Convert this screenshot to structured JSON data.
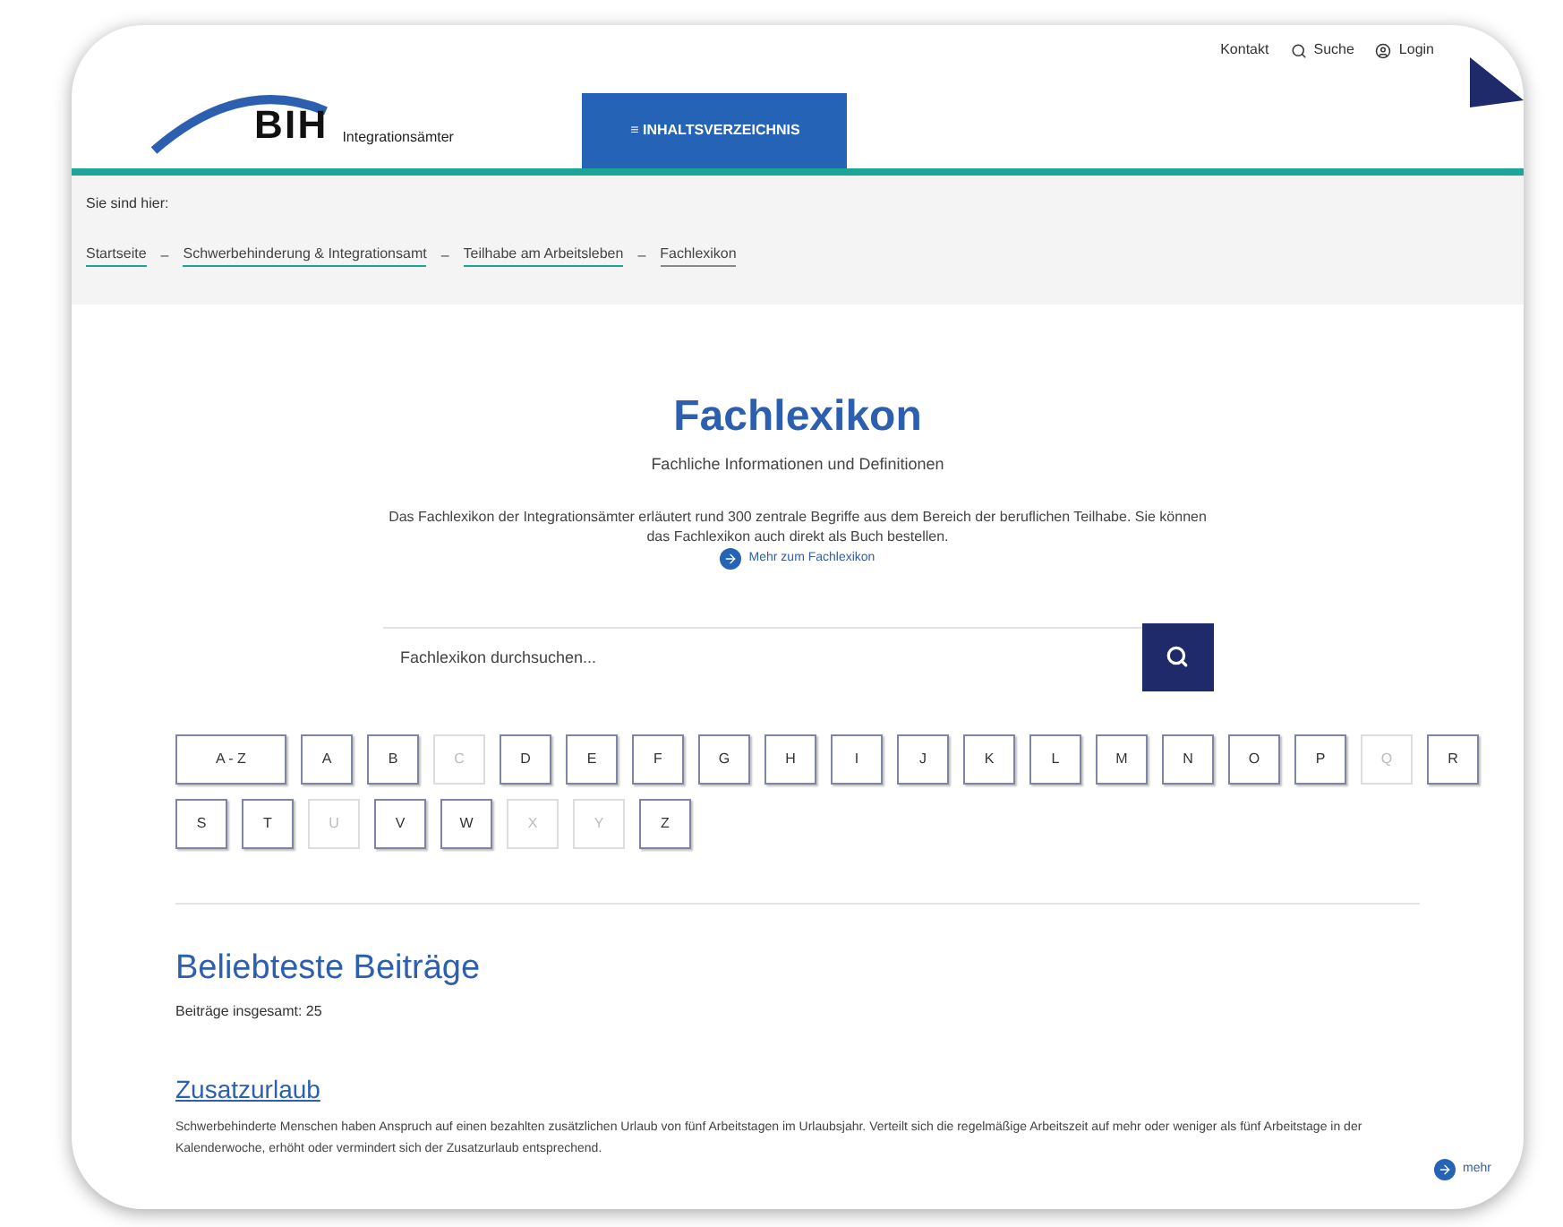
{
  "header": {
    "logo_text": "BIH",
    "logo_subtitle": "Integrationsämter",
    "menu_button": "≡ INHALTSVERZEICHNIS",
    "top_links": [
      {
        "kind": "text",
        "label": "Kontakt"
      },
      {
        "kind": "search",
        "label": "Suche"
      },
      {
        "kind": "login",
        "label": "Login"
      }
    ]
  },
  "breadcrumb": {
    "label": "Sie sind hier:",
    "separator": "–",
    "items": [
      {
        "label": "Startseite",
        "current": false
      },
      {
        "label": "Schwerbehinderung & Integrationsamt",
        "current": false
      },
      {
        "label": "Teilhabe am Arbeitsleben",
        "current": false
      },
      {
        "label": "Fachlexikon",
        "current": true
      }
    ]
  },
  "intro": {
    "title": "Fachlexikon",
    "subtitle": "Fachliche Informationen und Definitionen",
    "text": "Das Fachlexikon der Integrationsämter erläutert rund 300 zentrale Begriffe aus dem Bereich der beruflichen Teilhabe. Sie können das Fachlexikon auch direkt als Buch bestellen.",
    "link": "Mehr zum Fachlexikon"
  },
  "search": {
    "placeholder": "Fachlexikon durchsuchen..."
  },
  "letters": [
    {
      "label": "A - Z",
      "disabled": false
    },
    {
      "label": "A",
      "disabled": false
    },
    {
      "label": "B",
      "disabled": false
    },
    {
      "label": "C",
      "disabled": true
    },
    {
      "label": "D",
      "disabled": false
    },
    {
      "label": "E",
      "disabled": false
    },
    {
      "label": "F",
      "disabled": false
    },
    {
      "label": "G",
      "disabled": false
    },
    {
      "label": "H",
      "disabled": false
    },
    {
      "label": "I",
      "disabled": false
    },
    {
      "label": "J",
      "disabled": false
    },
    {
      "label": "K",
      "disabled": false
    },
    {
      "label": "L",
      "disabled": false
    },
    {
      "label": "M",
      "disabled": false
    },
    {
      "label": "N",
      "disabled": false
    },
    {
      "label": "O",
      "disabled": false
    },
    {
      "label": "P",
      "disabled": false
    },
    {
      "label": "Q",
      "disabled": true
    },
    {
      "label": "R",
      "disabled": false
    },
    {
      "label": "S",
      "disabled": false
    },
    {
      "label": "T",
      "disabled": false
    },
    {
      "label": "U",
      "disabled": true
    },
    {
      "label": "V",
      "disabled": false
    },
    {
      "label": "W",
      "disabled": false
    },
    {
      "label": "X",
      "disabled": true
    },
    {
      "label": "Y",
      "disabled": true
    },
    {
      "label": "Z",
      "disabled": false
    }
  ],
  "popular": {
    "title": "Beliebteste Beiträge",
    "count": "Beiträge insgesamt: 25",
    "articles": [
      {
        "title": "Zusatzurlaub",
        "text": "Schwerbehinderte Menschen haben Anspruch auf einen bezahlten zusätzlichen Urlaub von fünf Arbeitstagen im Urlaubsjahr. Verteilt sich die regelmäßige Arbeitszeit auf mehr oder weniger als fünf Arbeitstage in der Kalenderwoche, erhöht oder vermindert sich der Zusatzurlaub entsprechend.",
        "more": "mehr"
      }
    ]
  }
}
